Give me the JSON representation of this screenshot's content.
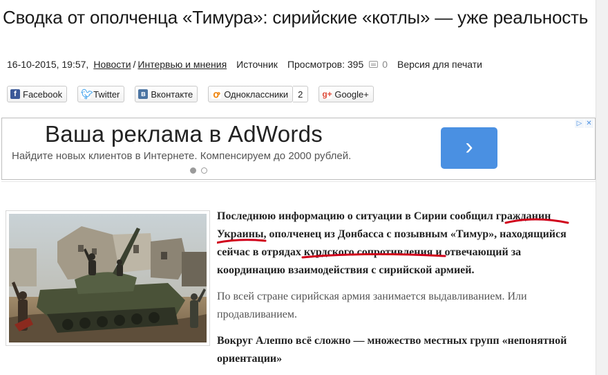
{
  "article": {
    "title": "Сводка от ополченца «Тимура»: сирийские «котлы» — уже реальность",
    "meta": {
      "datetime": "16-10-2015, 19:57,",
      "category_1": "Новости",
      "separator": "/",
      "category_2": "Интервью и мнения",
      "source": "Источник",
      "views": "Просмотров: 395",
      "comments": "0",
      "print": "Версия для печати"
    },
    "paragraphs": [
      "Последнюю информацию о ситуации в Сирии сообщил гражданин Украины, ополченец из Донбасса с позывным «Тимур», находящийся сейчас в отрядах курдского сопротивления и отвечающий за координацию взаимодействия с сирийской армией.",
      "По всей стране сирийская армия занимается выдавливанием. Или продавливанием.",
      "Вокруг Алеппо всё сложно — множество местных групп «непонятной ориентации»"
    ]
  },
  "share": {
    "facebook": "Facebook",
    "twitter": "Twitter",
    "vkontakte": "Вконтакте",
    "odnoklassniki": "Одноклассники",
    "odnoklassniki_count": "2",
    "googleplus": "Google+"
  },
  "ad": {
    "headline": "Ваша реклама в AdWords",
    "text": "Найдите новых клиентов в Интернете. Компенсируем до 2000 рублей.",
    "arrow": "›",
    "active_slide": 1,
    "slides": 2
  },
  "colors": {
    "ad_button": "#4a90e2",
    "annotation_red": "#d0021b"
  }
}
